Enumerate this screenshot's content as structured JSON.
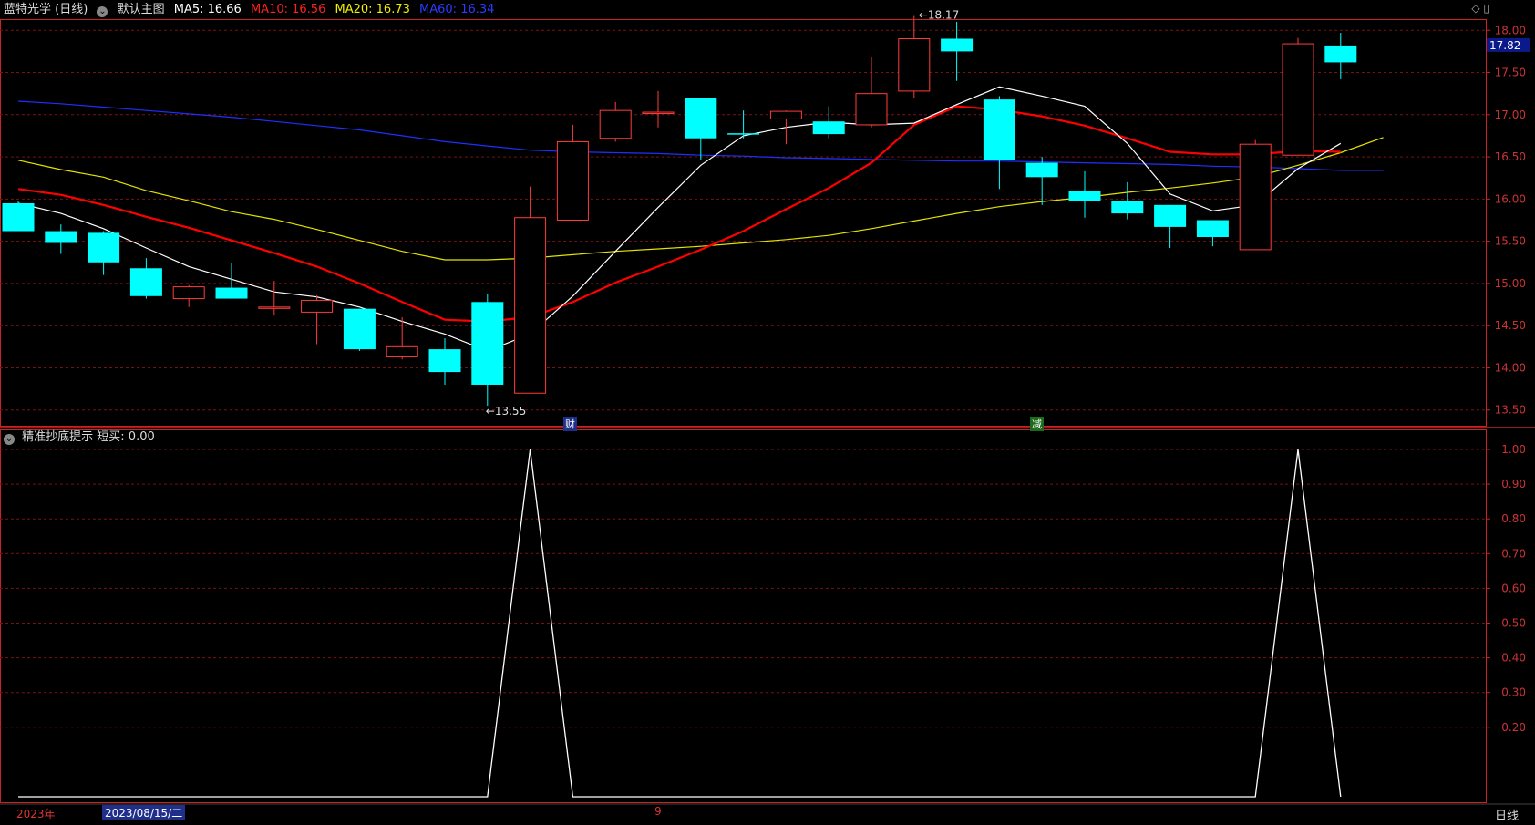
{
  "header": {
    "stock": "蓝特光学 (日线)",
    "template": "默认主图",
    "ma5_label": "MA5: 16.66",
    "ma10_label": "MA10: 16.56",
    "ma20_label": "MA20: 16.73",
    "ma60_label": "MA60: 16.34"
  },
  "indicator_header": {
    "name": "精准抄底提示",
    "value_label": "短买: 0.00"
  },
  "footer": {
    "year": "2023年",
    "date": "2023/08/15/二",
    "marker": "9",
    "period": "日线"
  },
  "badges": {
    "fin": "财",
    "cut": "减"
  },
  "colors": {
    "up": "#ff3b3b",
    "down": "#00ffff",
    "ma5": "#ffffff",
    "ma10": "#ff0000",
    "ma20": "#e3e300",
    "ma60": "#1f2fff",
    "grid": "#7a1212",
    "axis": "#cc2222"
  },
  "chart_data": [
    {
      "type": "candlestick",
      "title": "蓝特光学 (日线)",
      "ylim": [
        13.4,
        18.1
      ],
      "y_ticks": [
        "18.00",
        "17.50",
        "17.00",
        "16.50",
        "16.00",
        "15.50",
        "15.00",
        "14.50",
        "14.00",
        "13.50"
      ],
      "last_price_label": "17.82",
      "annotations": [
        {
          "text": "18.17",
          "index": 21
        },
        {
          "text": "13.55",
          "index": 11
        }
      ],
      "candles": [
        {
          "o": 15.95,
          "h": 15.98,
          "l": 15.62,
          "c": 15.62
        },
        {
          "o": 15.62,
          "h": 15.7,
          "l": 15.35,
          "c": 15.48
        },
        {
          "o": 15.6,
          "h": 15.62,
          "l": 15.1,
          "c": 15.25
        },
        {
          "o": 15.18,
          "h": 15.3,
          "l": 14.82,
          "c": 14.85
        },
        {
          "o": 14.82,
          "h": 14.98,
          "l": 14.72,
          "c": 14.96
        },
        {
          "o": 14.95,
          "h": 15.24,
          "l": 14.82,
          "c": 14.82
        },
        {
          "o": 14.72,
          "h": 15.03,
          "l": 14.62,
          "c": 14.72
        },
        {
          "o": 14.66,
          "h": 14.86,
          "l": 14.28,
          "c": 14.8
        },
        {
          "o": 14.7,
          "h": 14.7,
          "l": 14.2,
          "c": 14.22
        },
        {
          "o": 14.13,
          "h": 14.6,
          "l": 14.1,
          "c": 14.25
        },
        {
          "o": 14.22,
          "h": 14.35,
          "l": 13.8,
          "c": 13.95
        },
        {
          "o": 14.78,
          "h": 14.88,
          "l": 13.55,
          "c": 13.8
        },
        {
          "o": 13.7,
          "h": 16.15,
          "l": 13.7,
          "c": 15.78
        },
        {
          "o": 15.75,
          "h": 16.88,
          "l": 15.75,
          "c": 16.68
        },
        {
          "o": 16.72,
          "h": 17.15,
          "l": 16.68,
          "c": 17.05
        },
        {
          "o": 17.03,
          "h": 17.28,
          "l": 16.85,
          "c": 17.03
        },
        {
          "o": 17.2,
          "h": 17.2,
          "l": 16.46,
          "c": 16.72
        },
        {
          "o": 16.78,
          "h": 17.05,
          "l": 16.72,
          "c": 16.77
        },
        {
          "o": 16.95,
          "h": 17.05,
          "l": 16.65,
          "c": 17.04
        },
        {
          "o": 16.92,
          "h": 17.1,
          "l": 16.72,
          "c": 16.77
        },
        {
          "o": 16.88,
          "h": 17.68,
          "l": 16.85,
          "c": 17.25
        },
        {
          "o": 17.28,
          "h": 18.17,
          "l": 17.2,
          "c": 17.9
        },
        {
          "o": 17.9,
          "h": 18.1,
          "l": 17.4,
          "c": 17.75
        },
        {
          "o": 17.18,
          "h": 17.22,
          "l": 16.12,
          "c": 16.46
        },
        {
          "o": 16.43,
          "h": 16.5,
          "l": 15.93,
          "c": 16.26
        },
        {
          "o": 16.1,
          "h": 16.33,
          "l": 15.78,
          "c": 15.98
        },
        {
          "o": 15.98,
          "h": 16.2,
          "l": 15.76,
          "c": 15.83
        },
        {
          "o": 15.93,
          "h": 15.93,
          "l": 15.42,
          "c": 15.67
        },
        {
          "o": 15.75,
          "h": 15.75,
          "l": 15.44,
          "c": 15.55
        },
        {
          "o": 15.4,
          "h": 16.7,
          "l": 15.4,
          "c": 16.65
        },
        {
          "o": 16.52,
          "h": 17.91,
          "l": 16.52,
          "c": 17.84
        },
        {
          "o": 17.82,
          "h": 17.97,
          "l": 17.42,
          "c": 17.62
        }
      ],
      "ma": {
        "MA5": [
          15.95,
          15.83,
          15.65,
          15.42,
          15.2,
          15.05,
          14.9,
          14.84,
          14.72,
          14.55,
          14.4,
          14.2,
          14.4,
          14.85,
          15.38,
          15.9,
          16.4,
          16.75,
          16.85,
          16.91,
          16.88,
          16.9,
          17.12,
          17.33,
          17.22,
          17.1,
          16.66,
          16.06,
          15.86,
          15.93,
          16.36,
          16.66
        ],
        "MA10": [
          16.12,
          16.05,
          15.93,
          15.79,
          15.66,
          15.51,
          15.36,
          15.2,
          15.0,
          14.78,
          14.57,
          14.55,
          14.6,
          14.78,
          15.01,
          15.2,
          15.4,
          15.62,
          15.88,
          16.13,
          16.43,
          16.88,
          17.1,
          17.06,
          16.98,
          16.87,
          16.72,
          16.56,
          16.53,
          16.53,
          16.57,
          16.56
        ],
        "MA20": [
          16.46,
          16.35,
          16.26,
          16.1,
          15.98,
          15.85,
          15.76,
          15.64,
          15.51,
          15.38,
          15.28,
          15.28,
          15.3,
          15.34,
          15.38,
          15.41,
          15.44,
          15.48,
          15.52,
          15.57,
          15.65,
          15.74,
          15.83,
          15.91,
          15.97,
          16.02,
          16.08,
          16.13,
          16.19,
          16.26,
          16.4,
          16.55,
          16.73
        ],
        "MA60": [
          17.16,
          17.13,
          17.09,
          17.05,
          17.01,
          16.97,
          16.92,
          16.87,
          16.82,
          16.75,
          16.68,
          16.63,
          16.58,
          16.56,
          16.55,
          16.54,
          16.52,
          16.51,
          16.49,
          16.48,
          16.47,
          16.46,
          16.45,
          16.45,
          16.44,
          16.43,
          16.42,
          16.41,
          16.39,
          16.38,
          16.36,
          16.34,
          16.34
        ]
      }
    },
    {
      "type": "line",
      "title": "精准抄底提示",
      "ylim": [
        0,
        1
      ],
      "y_ticks": [
        "1.00",
        "0.90",
        "0.80",
        "0.70",
        "0.60",
        "0.50",
        "0.40",
        "0.30",
        "0.20"
      ],
      "series": [
        {
          "name": "短买",
          "values": [
            0,
            0,
            0,
            0,
            0,
            0,
            0,
            0,
            0,
            0,
            0,
            0,
            1,
            0,
            0,
            0,
            0,
            0,
            0,
            0,
            0,
            0,
            0,
            0,
            0,
            0,
            0,
            0,
            0,
            0,
            1,
            0
          ]
        }
      ]
    }
  ]
}
